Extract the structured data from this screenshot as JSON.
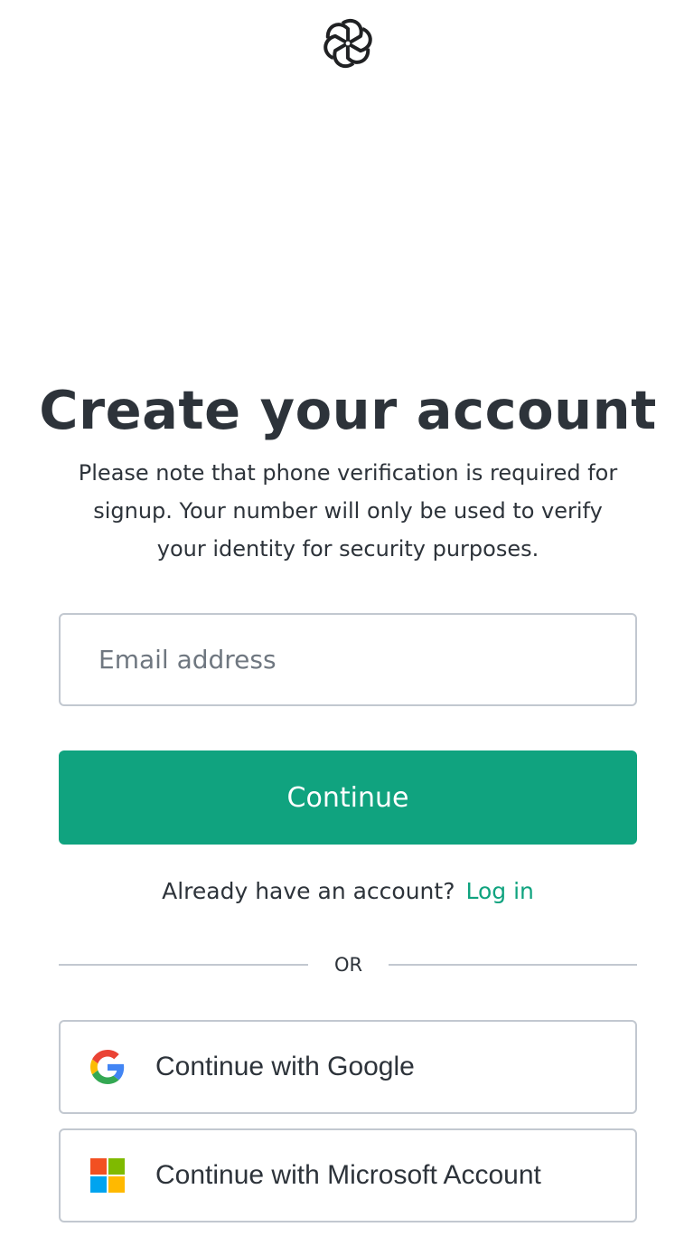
{
  "brand": {
    "logo_icon": "openai-logo-icon"
  },
  "heading": {
    "title": "Create your account",
    "subtitle_line1": "Please note that phone verification is required for",
    "subtitle_line2": "signup. Your number will only be used to verify",
    "subtitle_line3": "your identity for security purposes."
  },
  "form": {
    "email_placeholder": "Email address",
    "email_value": "",
    "continue_label": "Continue"
  },
  "login_prompt": {
    "text": "Already have an account?",
    "link_label": "Log in"
  },
  "divider": {
    "label": "OR"
  },
  "social": {
    "google_label": "Continue with Google",
    "google_icon": "google-icon",
    "microsoft_label": "Continue with Microsoft Account",
    "microsoft_icon": "microsoft-icon"
  },
  "colors": {
    "accent": "#10a37f",
    "text": "#2d333a",
    "border": "#c2c8d0",
    "placeholder": "#6f7780"
  }
}
